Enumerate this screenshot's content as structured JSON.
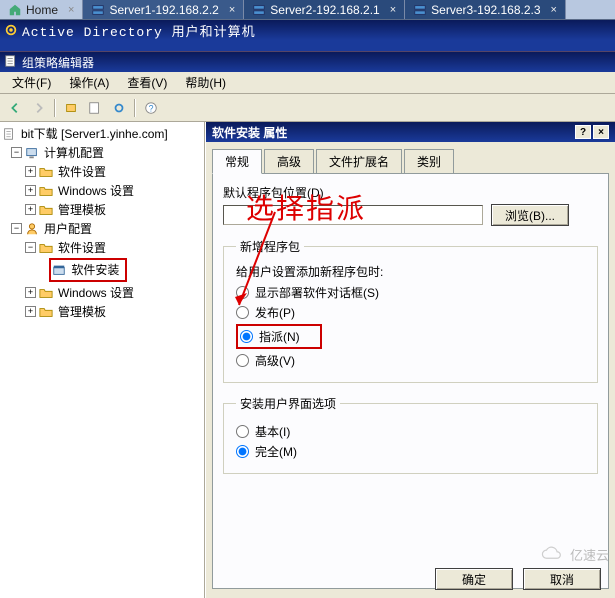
{
  "top_tabs": {
    "home": "Home",
    "server1": "Server1-192.168.2.2",
    "server2": "Server2-192.168.2.1",
    "server3": "Server3-192.168.2.3"
  },
  "ad_title": "Active Directory 用户和计算机",
  "gpo_title": "组策略编辑器",
  "menu": {
    "file": "文件(F)",
    "action": "操作(A)",
    "view": "查看(V)",
    "help": "帮助(H)"
  },
  "tree": {
    "root": "bit下载 [Server1.yinhe.com]",
    "computer_config": "计算机配置",
    "software_settings": "软件设置",
    "windows_settings": "Windows 设置",
    "admin_templates": "管理模板",
    "user_config": "用户配置",
    "software_install": "软件安装",
    "windows_settings2": "Windows 设置",
    "admin_templates2": "管理模板"
  },
  "dialog": {
    "title": "软件安装 属性",
    "tabs": {
      "general": "常规",
      "advanced": "高级",
      "file_ext": "文件扩展名",
      "categories": "类别"
    },
    "default_pkg_label": "默认程序包位置(D)",
    "default_pkg_value": "",
    "browse": "浏览(B)...",
    "group_new": "新增程序包",
    "new_pkg_text": "给用户设置添加新程序包时:",
    "show_dialog": "显示部署软件对话框(S)",
    "publish": "发布(P)",
    "assign": "指派(N)",
    "advanced": "高级(V)",
    "group_ui": "安装用户界面选项",
    "basic": "基本(I)",
    "full": "完全(M)",
    "ok": "确定",
    "cancel": "取消"
  },
  "annotation": "选择指派",
  "watermark": "亿速云"
}
